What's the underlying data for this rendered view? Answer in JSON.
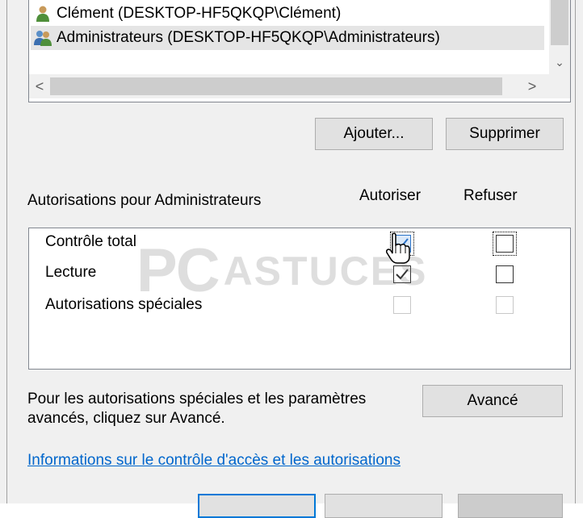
{
  "user_list": {
    "items": [
      {
        "label": "Clément (DESKTOP-HF5QKQP\\Clément)",
        "icon": "user-icon"
      },
      {
        "label": "Administrateurs (DESKTOP-HF5QKQP\\Administrateurs)",
        "icon": "group-icon",
        "selected": true
      }
    ],
    "scroll_left_glyph": "<",
    "scroll_right_glyph": ">",
    "scroll_down_glyph": "⌄"
  },
  "buttons": {
    "add": "Ajouter...",
    "remove": "Supprimer",
    "advanced": "Avancé"
  },
  "permissions": {
    "title": "Autorisations pour Administrateurs",
    "allow_header": "Autoriser",
    "deny_header": "Refuser",
    "rows": [
      {
        "label": "Contrôle total",
        "allow": true,
        "deny": false
      },
      {
        "label": "Lecture",
        "allow": true,
        "deny": false
      },
      {
        "label": "Autorisations spéciales",
        "allow": false,
        "deny": false,
        "disabled": true
      }
    ]
  },
  "advanced_text_line1": "Pour les autorisations spéciales et les paramètres",
  "advanced_text_line2": "avancés, cliquez sur Avancé.",
  "access_link": "Informations sur le contrôle d'accès et les autorisations",
  "watermark": {
    "part1": "PC",
    "part2": "ASTUCES"
  },
  "colors": {
    "link": "#0066cc",
    "primary_border": "#0078d7",
    "dialog_bg": "#f0f0f0"
  }
}
